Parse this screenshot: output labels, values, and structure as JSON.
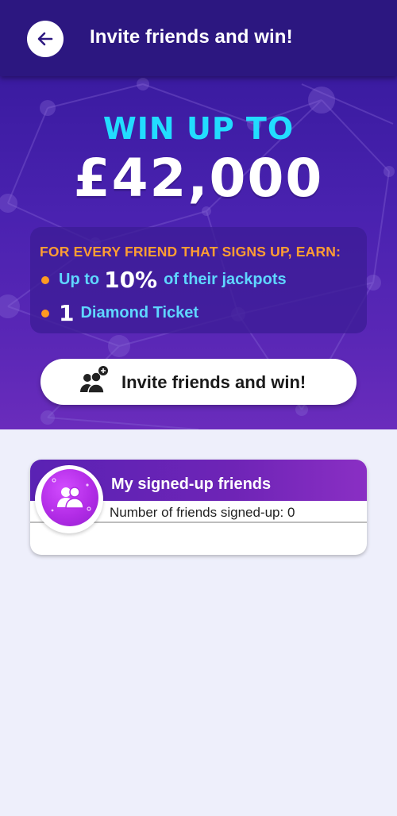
{
  "header": {
    "title": "Invite friends and win!",
    "back_icon": "arrow-left-icon"
  },
  "hero": {
    "headline": "WIN UP TO",
    "amount": "£42,000",
    "earn": {
      "title": "FOR EVERY FRIEND THAT SIGNS UP, EARN:",
      "item1_prefix": "Up to",
      "item1_value": "10%",
      "item1_suffix": "of their jackpots",
      "item2_value": "1",
      "item2_suffix": "Diamond Ticket"
    },
    "invite_button": {
      "label": "Invite friends and win!",
      "icon": "add-user-group-icon"
    }
  },
  "friends_card": {
    "title": "My signed-up friends",
    "count_text": "Number of friends signed-up: 0",
    "icon": "friends-group-icon"
  },
  "colors": {
    "header_bg": "#2c1780",
    "headline": "#22ddff",
    "earn_title": "#ff9d33",
    "earn_text": "#5fd6ff",
    "bullet": "#ff9a22",
    "avatar": "#b22ce6",
    "page_bg": "#eeeffb"
  }
}
